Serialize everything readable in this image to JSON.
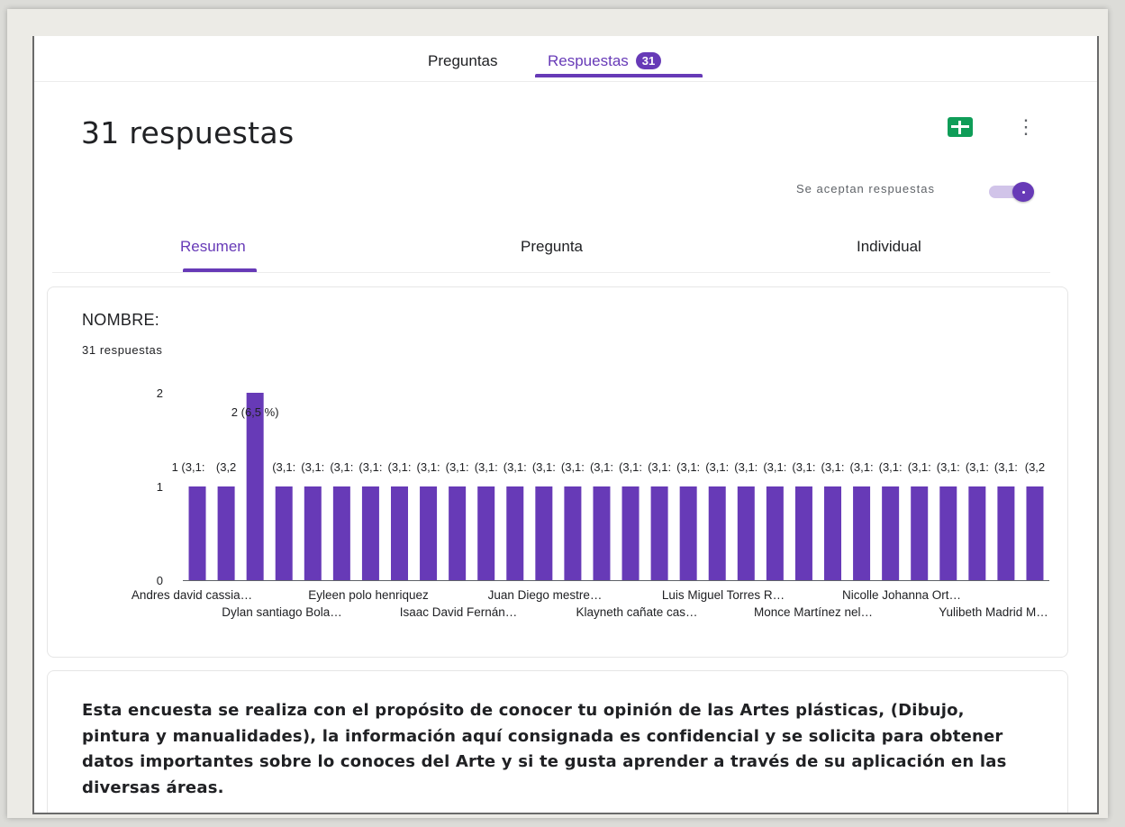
{
  "tabs": {
    "preguntas": "Preguntas",
    "respuestas": "Respuestas",
    "respuestas_count": "31"
  },
  "header": {
    "title": "31 respuestas",
    "accepting_label": "Se aceptan respuestas",
    "accepting": true,
    "sheets_icon": "google-sheets-icon",
    "more_icon": "more-vert-icon"
  },
  "subtabs": {
    "summary": "Resumen",
    "question": "Pregunta",
    "individual": "Individual"
  },
  "question": {
    "title": "NOMBRE:",
    "count_label": "31 respuestas"
  },
  "chart_data": {
    "type": "bar",
    "ylim": [
      0,
      2
    ],
    "yticks": [
      "0",
      "1",
      "2"
    ],
    "values": [
      1,
      1,
      2,
      1,
      1,
      1,
      1,
      1,
      1,
      1,
      1,
      1,
      1,
      1,
      1,
      1,
      1,
      1,
      1,
      1,
      1,
      1,
      1,
      1,
      1,
      1,
      1,
      1,
      1,
      1
    ],
    "bar_labels": [
      "1 (3,1:",
      "(3,2",
      "2 (6,5 %)",
      "(3,1:",
      "(3,1:",
      "(3,1:",
      "(3,1:",
      "(3,1:",
      "(3,1:",
      "(3,1:",
      "(3,1:",
      "(3,1:",
      "(3,1:",
      "(3,1:",
      "(3,1:",
      "(3,1:",
      "(3,1:",
      "(3,1:",
      "(3,1:",
      "(3,1:",
      "(3,1:",
      "(3,1:",
      "(3,1:",
      "(3,1:",
      "(3,1:",
      "(3,1:",
      "(3,1:",
      "(3,1:",
      "(3,1:",
      "(3,2"
    ],
    "x_labels_row1": [
      "Andres david cassia…",
      "Eyleen polo henriquez",
      "Juan Diego mestre…",
      "Luis Miguel Torres R…",
      "Nicolle Johanna Ort…"
    ],
    "x_labels_row2": [
      "Dylan santiago Bola…",
      "Isaac David Fernán…",
      "Klayneth cañate cas…",
      "Monce Martínez nel…",
      "Yulibeth Madrid M…"
    ],
    "bar_color": "#673ab7"
  },
  "description": {
    "text": "Esta encuesta se realiza con el propósito de conocer tu opinión de las Artes plásticas, (Dibujo, pintura y manualidades), la información aquí consignada es confidencial y se solicita para obtener datos importantes sobre lo conoces del Arte y si te gusta aprender a través de su aplicación en las diversas áreas."
  }
}
